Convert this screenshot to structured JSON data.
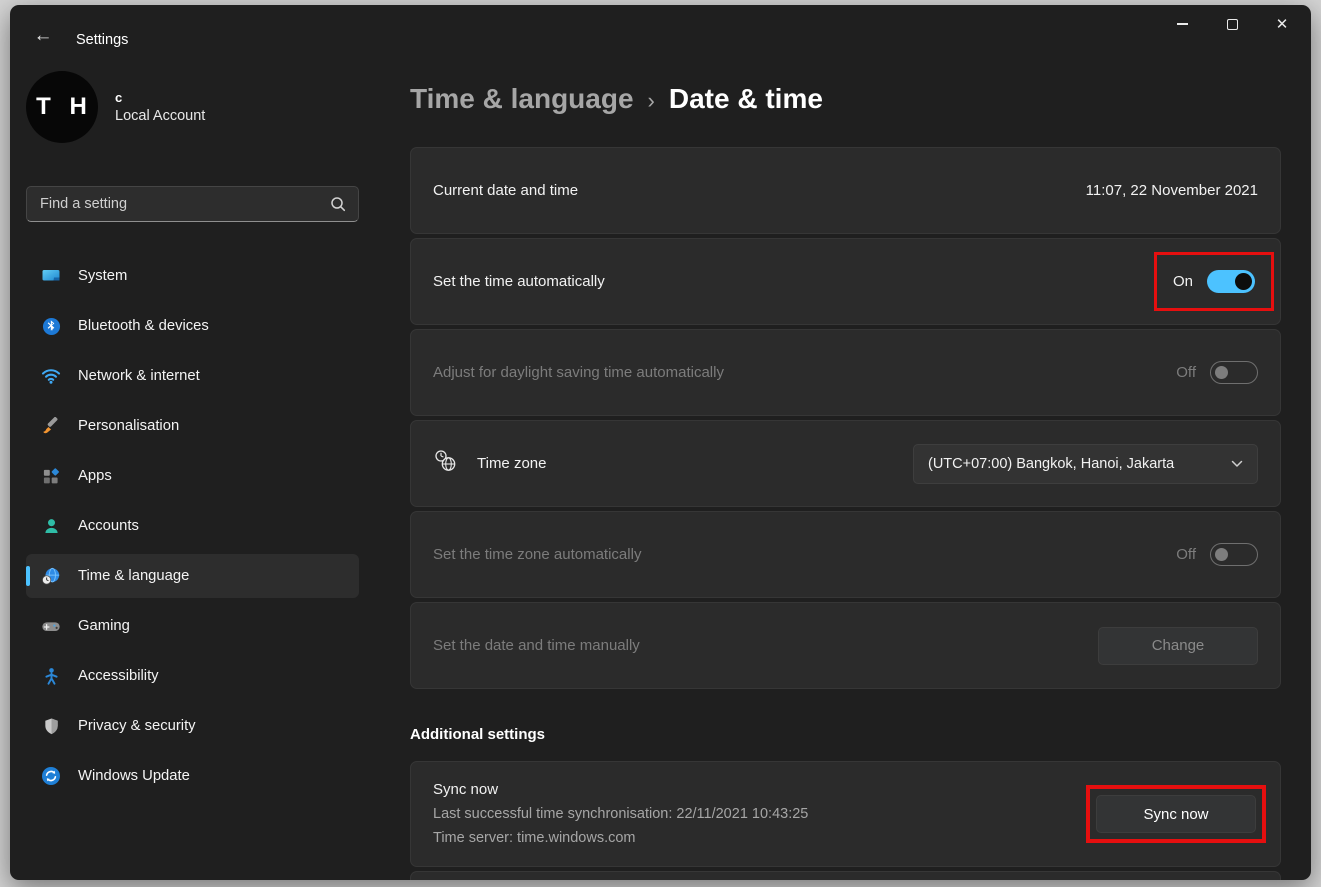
{
  "colors": {
    "accent": "#4cc2ff",
    "highlight_red": "#e60f0f",
    "window_bg": "#1f1f1f",
    "card_bg": "#2b2b2b"
  },
  "titlebar": {
    "title": "Settings",
    "back_icon": "arrow-left",
    "controls": [
      "minimize",
      "maximize",
      "close"
    ]
  },
  "sidebar": {
    "user": {
      "initials": "T H",
      "name": "c",
      "subtitle": "Local Account"
    },
    "search": {
      "placeholder": "Find a setting",
      "icon": "search"
    },
    "items": [
      {
        "label": "System",
        "icon": "system",
        "selected": false
      },
      {
        "label": "Bluetooth & devices",
        "icon": "bluetooth",
        "selected": false
      },
      {
        "label": "Network & internet",
        "icon": "network",
        "selected": false
      },
      {
        "label": "Personalisation",
        "icon": "personalisation",
        "selected": false
      },
      {
        "label": "Apps",
        "icon": "apps",
        "selected": false
      },
      {
        "label": "Accounts",
        "icon": "accounts",
        "selected": false
      },
      {
        "label": "Time & language",
        "icon": "time-language",
        "selected": true
      },
      {
        "label": "Gaming",
        "icon": "gaming",
        "selected": false
      },
      {
        "label": "Accessibility",
        "icon": "accessibility",
        "selected": false
      },
      {
        "label": "Privacy & security",
        "icon": "privacy-security",
        "selected": false
      },
      {
        "label": "Windows Update",
        "icon": "windows-update",
        "selected": false
      }
    ]
  },
  "header": {
    "breadcrumb_parent": "Time & language",
    "separator": "›",
    "breadcrumb_current": "Date & time"
  },
  "rows": {
    "current_datetime": {
      "label": "Current date and time",
      "value": "11:07, 22 November 2021"
    },
    "set_time_auto": {
      "label": "Set the time automatically",
      "state": "On",
      "highlighted": true
    },
    "dst_auto": {
      "label": "Adjust for daylight saving time automatically",
      "state": "Off",
      "disabled": true
    },
    "time_zone": {
      "label": "Time zone",
      "value": "(UTC+07:00) Bangkok, Hanoi, Jakarta",
      "icon": "timezone-globe-clock"
    },
    "set_zone_auto": {
      "label": "Set the time zone automatically",
      "state": "Off",
      "disabled": true
    },
    "set_manual": {
      "label": "Set the date and time manually",
      "button_label": "Change",
      "disabled": true
    }
  },
  "additional": {
    "heading": "Additional settings",
    "sync": {
      "title": "Sync now",
      "last_sync": "Last successful time synchronisation: 22/11/2021 10:43:25",
      "server": "Time server: time.windows.com",
      "button_label": "Sync now",
      "highlighted": true
    }
  }
}
